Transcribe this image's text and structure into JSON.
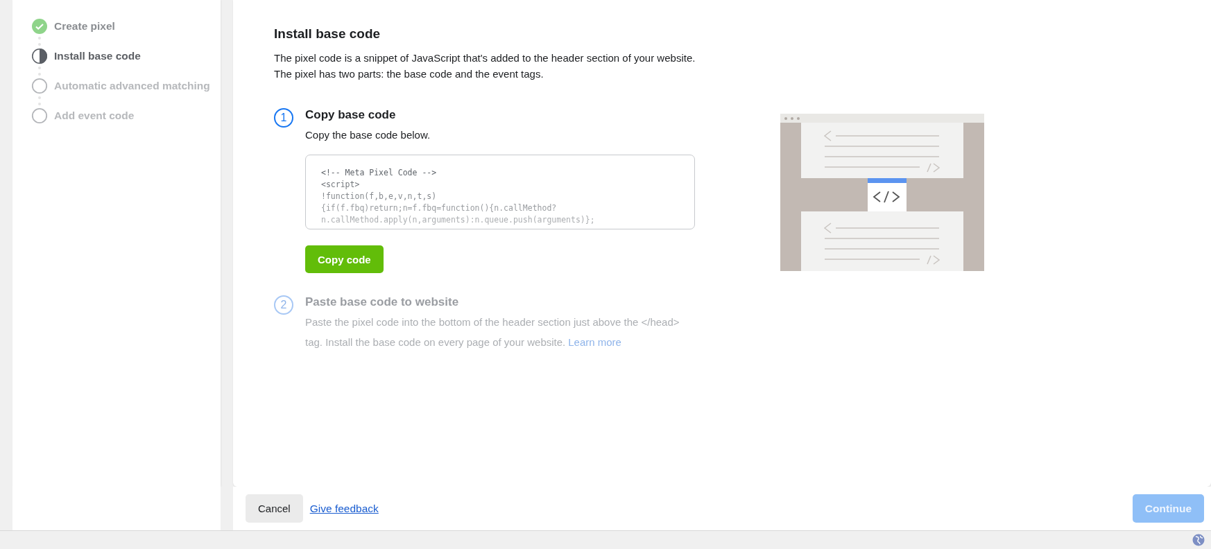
{
  "sidebar": {
    "steps": [
      {
        "label": "Create pixel",
        "completed": true,
        "selected": false
      },
      {
        "label": "Install base code",
        "completed": false,
        "selected": true
      },
      {
        "label": "Automatic advanced matching",
        "completed": false,
        "selected": false
      },
      {
        "label": "Add event code",
        "completed": false,
        "selected": false
      }
    ]
  },
  "main": {
    "title": "Install base code",
    "description": [
      "The pixel code is a snippet of JavaScript that's added to the header section of your website.",
      "The pixel has two parts: the base code and the event tags."
    ],
    "steps": [
      {
        "number": "1",
        "title": "Copy base code",
        "active": true,
        "text": "Copy the base code below.",
        "code": [
          "<!-- Meta Pixel Code -->",
          "<script>",
          "!function(f,b,e,v,n,t,s)",
          "{if(f.fbq)return;n=f.fbq=function(){n.callMethod?",
          "n.callMethod.apply(n,arguments):n.queue.push(arguments)};"
        ],
        "button": "Copy code"
      },
      {
        "number": "2",
        "title": "Paste base code to website",
        "active": false,
        "text": "Paste the pixel code into the bottom of the header section just above the </head> tag. Install the base code on every page of your website.",
        "link": "Learn more"
      }
    ]
  },
  "footer": {
    "cancel": "Cancel",
    "feedback": "Give feedback",
    "continue": {
      "label": "Continue",
      "disabled": true
    }
  }
}
